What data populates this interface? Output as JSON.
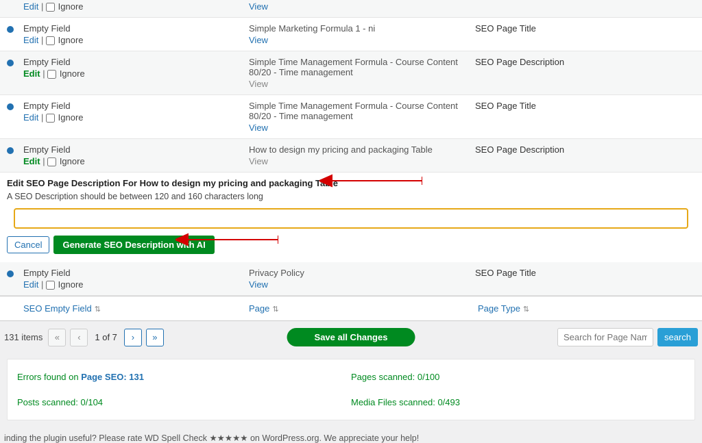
{
  "common": {
    "empty_field": "Empty Field",
    "edit": "Edit",
    "ignore": "Ignore",
    "view": "View"
  },
  "rows": [
    {
      "page": "",
      "type": "",
      "view_muted": false
    },
    {
      "page": "Simple Marketing Formula 1 - ni",
      "type": "SEO Page Title",
      "view_muted": false,
      "edit_green": false
    },
    {
      "page": "Simple Time Management Formula - Course Content 80/20 - Time management",
      "type": "SEO Page Description",
      "view_muted": true,
      "edit_green": true
    },
    {
      "page": "Simple Time Management Formula - Course Content 80/20 - Time management",
      "type": "SEO Page Title",
      "view_muted": false,
      "edit_green": false
    },
    {
      "page": "How to design my pricing and packaging Table",
      "type": "SEO Page Description",
      "view_muted": true,
      "edit_green": true
    },
    {
      "page": "Privacy Policy",
      "type": "SEO Page Title",
      "view_muted": false,
      "edit_green": false
    }
  ],
  "editor": {
    "title": "Edit SEO Page Description For How to design my pricing and packaging Table",
    "subtitle": "A SEO Description should be between 120 and 160 characters long",
    "cancel": "Cancel",
    "generate": "Generate SEO Description with AI",
    "value": ""
  },
  "headers": {
    "c1": "SEO Empty Field",
    "c2": "Page",
    "c3": "Page Type"
  },
  "footer": {
    "items": "131 items",
    "page_info": "1 of 7",
    "save": "Save all Changes",
    "search_placeholder": "Search for Page Names",
    "search_btn": "search"
  },
  "stats": {
    "errors_prefix": "Errors found on ",
    "errors_link": "Page SEO: 131",
    "posts": "Posts scanned: 0/104",
    "pages": "Pages scanned: 0/100",
    "media": "Media Files scanned: 0/493"
  },
  "bottom_cut": "inding the plugin useful? Please rate WD Spell Check ★★★★★ on WordPress.org. We appreciate your help!"
}
